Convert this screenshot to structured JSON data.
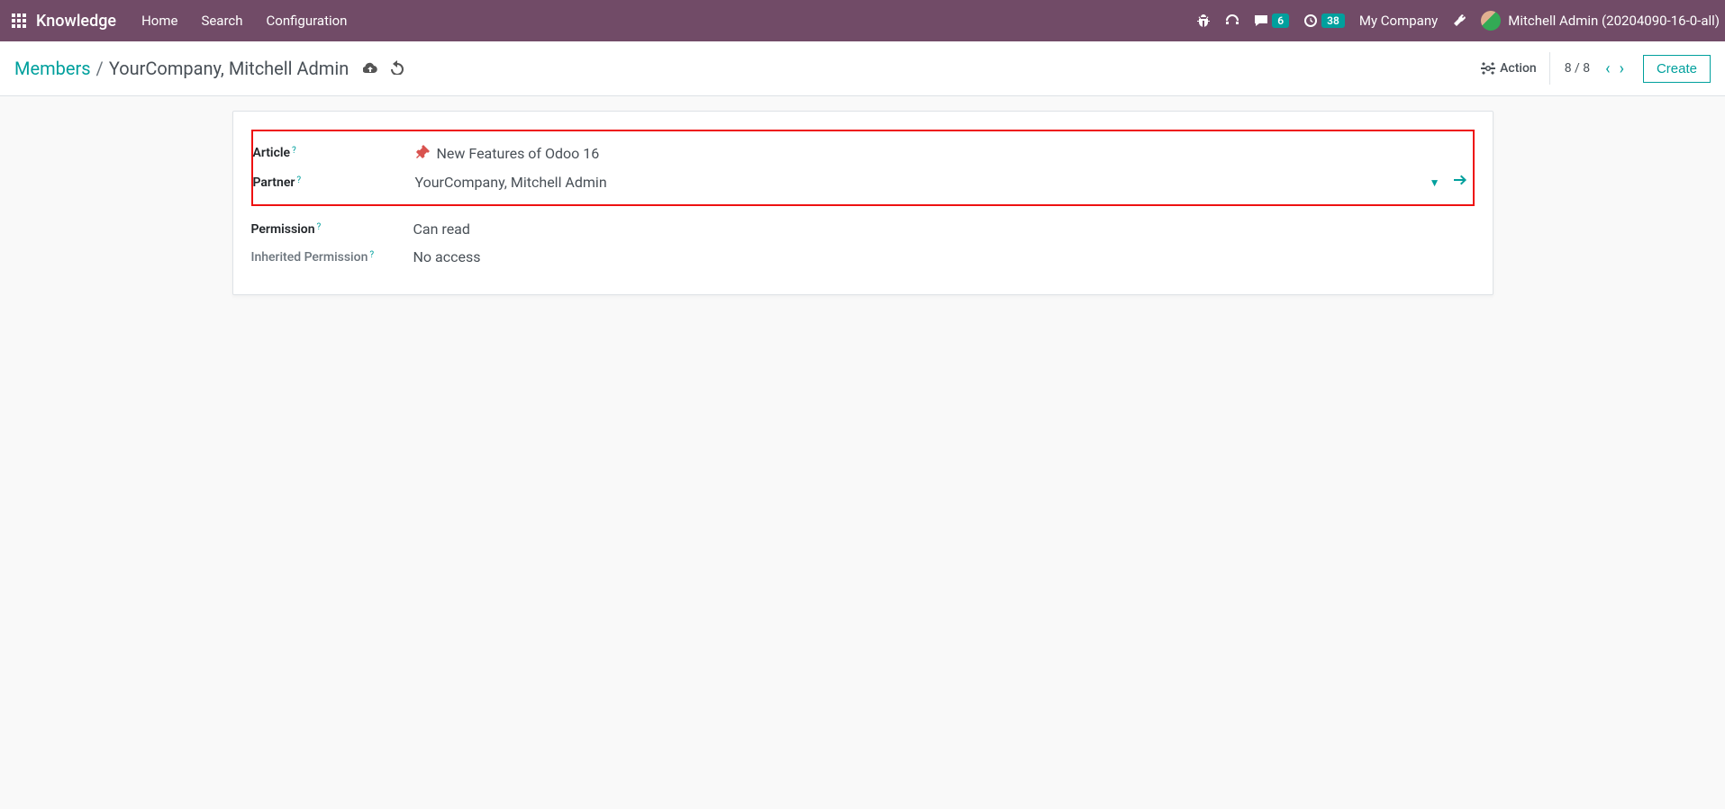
{
  "header": {
    "app_name": "Knowledge",
    "nav": {
      "home": "Home",
      "search": "Search",
      "configuration": "Configuration"
    },
    "messages_badge": "6",
    "activities_badge": "38",
    "company": "My Company",
    "user": "Mitchell Admin (20204090-16-0-all)"
  },
  "control_panel": {
    "breadcrumb_link": "Members",
    "breadcrumb_current": "YourCompany, Mitchell Admin",
    "action_label": "Action",
    "pager": "8 / 8",
    "create_label": "Create"
  },
  "form": {
    "article": {
      "label": "Article",
      "value": "New Features of Odoo 16"
    },
    "partner": {
      "label": "Partner",
      "value": "YourCompany, Mitchell Admin"
    },
    "permission": {
      "label": "Permission",
      "value": "Can read"
    },
    "inherited": {
      "label": "Inherited Permission",
      "value": "No access"
    }
  }
}
